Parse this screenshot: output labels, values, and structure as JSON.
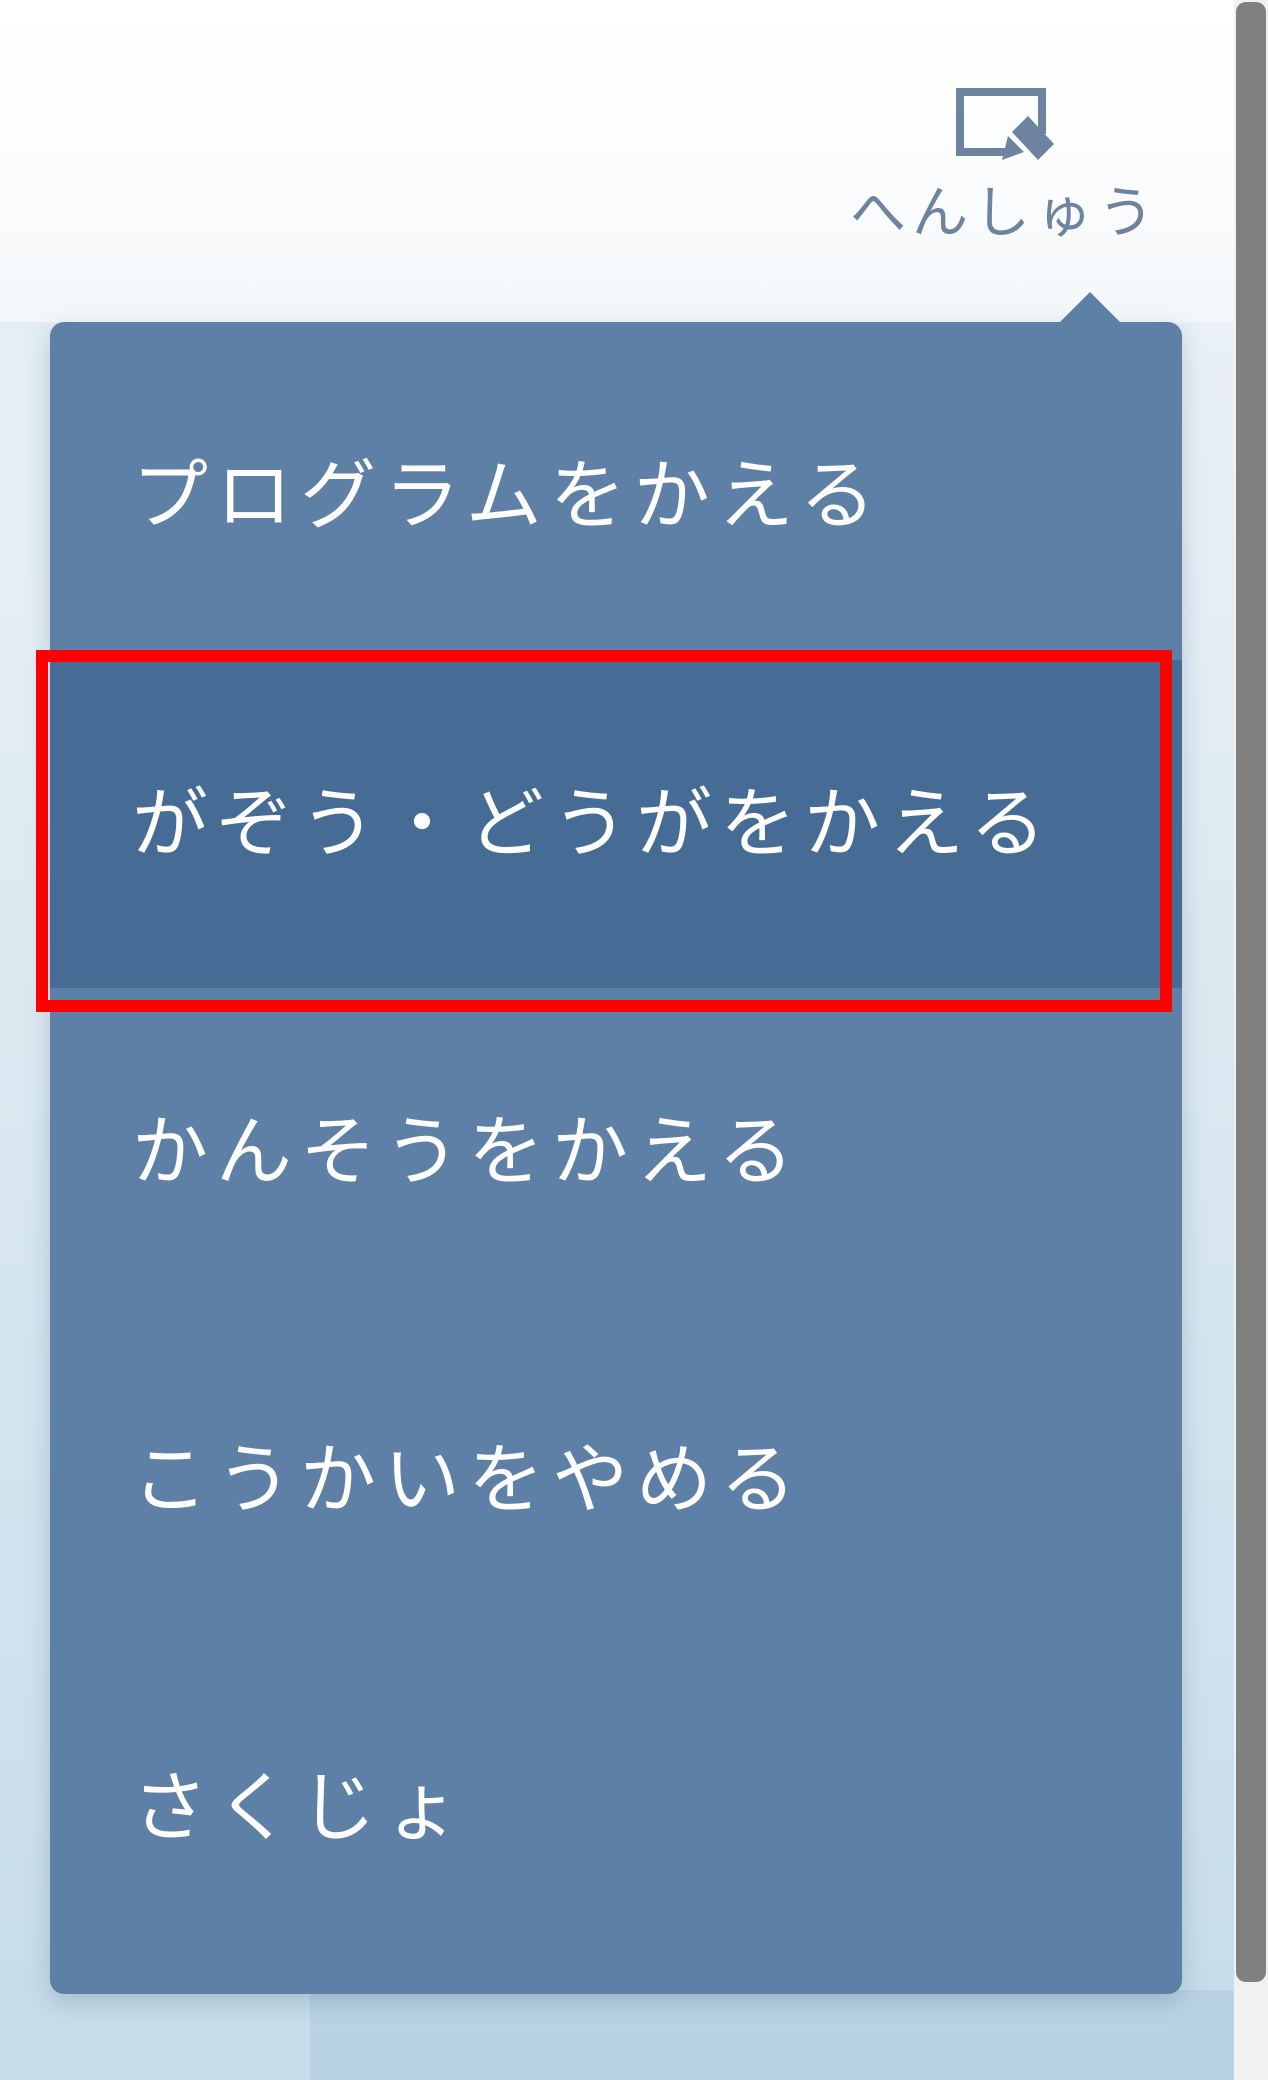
{
  "header": {
    "edit_label": "へんしゅう",
    "edit_icon": "edit-screen-pencil-icon"
  },
  "dropdown": {
    "items": [
      {
        "label": "プログラムをかえる"
      },
      {
        "label": "がぞう・どうがをかえる",
        "active": true
      },
      {
        "label": "かんそうをかえる"
      },
      {
        "label": "こうかいをやめる"
      },
      {
        "label": "さくじょ"
      }
    ]
  },
  "colors": {
    "menu_bg": "#5e80a6",
    "menu_active_bg": "#466c95",
    "menu_text": "#ffffff",
    "header_text": "#6d83a0",
    "highlight": "#ff0000",
    "scrollbar_thumb": "#808080"
  }
}
